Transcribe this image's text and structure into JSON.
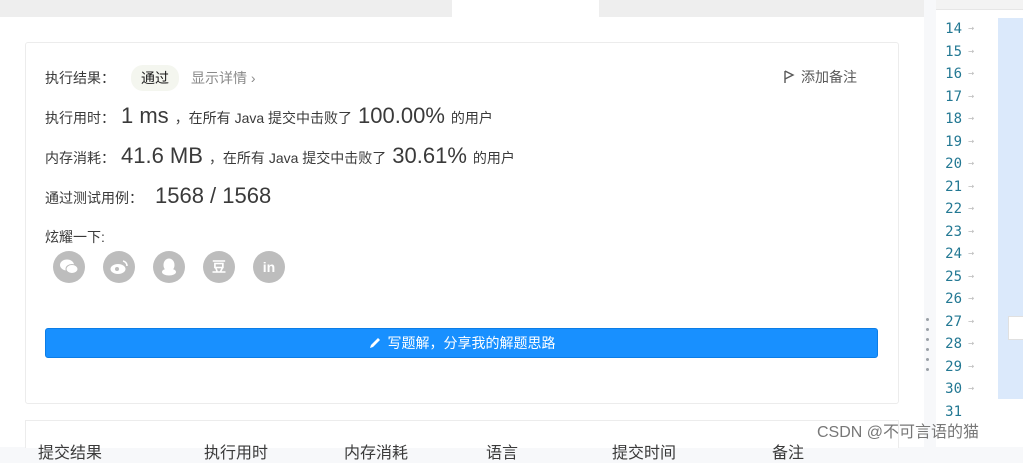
{
  "result": {
    "label": "执行结果：",
    "status": "通过",
    "details_link": "显示详情 ›",
    "add_note": "添加备注"
  },
  "runtime": {
    "label": "执行用时：",
    "value": "1 ms",
    "mid_text": "，在所有 Java 提交中击败了",
    "percent": "100.00%",
    "suffix": "的用户"
  },
  "memory": {
    "label": "内存消耗：",
    "value": "41.6 MB",
    "mid_text": "，在所有 Java 提交中击败了",
    "percent": "30.61%",
    "suffix": "的用户"
  },
  "tests": {
    "label": "通过测试用例：",
    "value": "1568 / 1568"
  },
  "share": {
    "label": "炫耀一下:",
    "icons": [
      "wechat-icon",
      "weibo-icon",
      "qq-icon",
      "douban-icon",
      "linkedin-icon"
    ],
    "douban_glyph": "豆",
    "linkedin_glyph": "in"
  },
  "solution_button": "写题解，分享我的解题思路",
  "table_headers": [
    "提交结果",
    "执行用时",
    "内存消耗",
    "语言",
    "提交时间",
    "备注"
  ],
  "line_numbers": [
    "14",
    "15",
    "16",
    "17",
    "18",
    "19",
    "20",
    "21",
    "22",
    "23",
    "24",
    "25",
    "26",
    "27",
    "28",
    "29",
    "30",
    "31"
  ],
  "watermark": "CSDN @不可言语的猫",
  "colors": {
    "primary": "#1890ff",
    "line_number": "#237893",
    "selection": "#dbe9fb"
  }
}
